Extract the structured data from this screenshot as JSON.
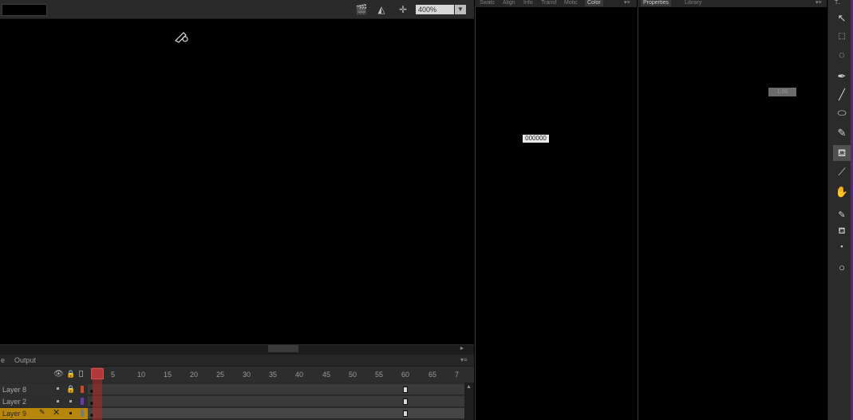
{
  "stage": {
    "zoom": "400%",
    "toolbar_icons": [
      "clapper-icon",
      "symbol-icon",
      "center-stage-icon"
    ]
  },
  "timeline": {
    "tabs": [
      "e",
      "Output"
    ],
    "frame_numbers": [
      "5",
      "10",
      "15",
      "20",
      "25",
      "30",
      "35",
      "40",
      "45",
      "50",
      "55",
      "60",
      "65",
      "7"
    ],
    "layers": [
      {
        "name": "Layer 8",
        "color": "#d04a2a",
        "selected": false
      },
      {
        "name": "Layer 2",
        "color": "#6a3ab0",
        "selected": false
      },
      {
        "name": "Layer 9",
        "color": "#7a7a7a",
        "selected": true
      }
    ]
  },
  "color_panel": {
    "tabs": [
      "Swatc",
      "Align",
      "Info",
      "Transf",
      "Motic",
      "Color"
    ],
    "hex_value": "000000"
  },
  "properties_panel": {
    "tabs": [
      "Properties",
      "Library"
    ],
    "field_value": "1.00"
  },
  "tools": [
    "selection-tool-icon",
    "subselection-tool-icon",
    "lasso-tool-icon",
    "pen-tool-icon",
    "line-tool-icon",
    "oval-tool-icon",
    "pencil-tool-icon",
    "paint-bucket-tool-icon",
    "eyedropper-tool-icon",
    "hand-tool-icon",
    "stroke-color-icon",
    "fill-color-icon",
    "swap-colors-icon",
    "object-drawing-icon"
  ]
}
